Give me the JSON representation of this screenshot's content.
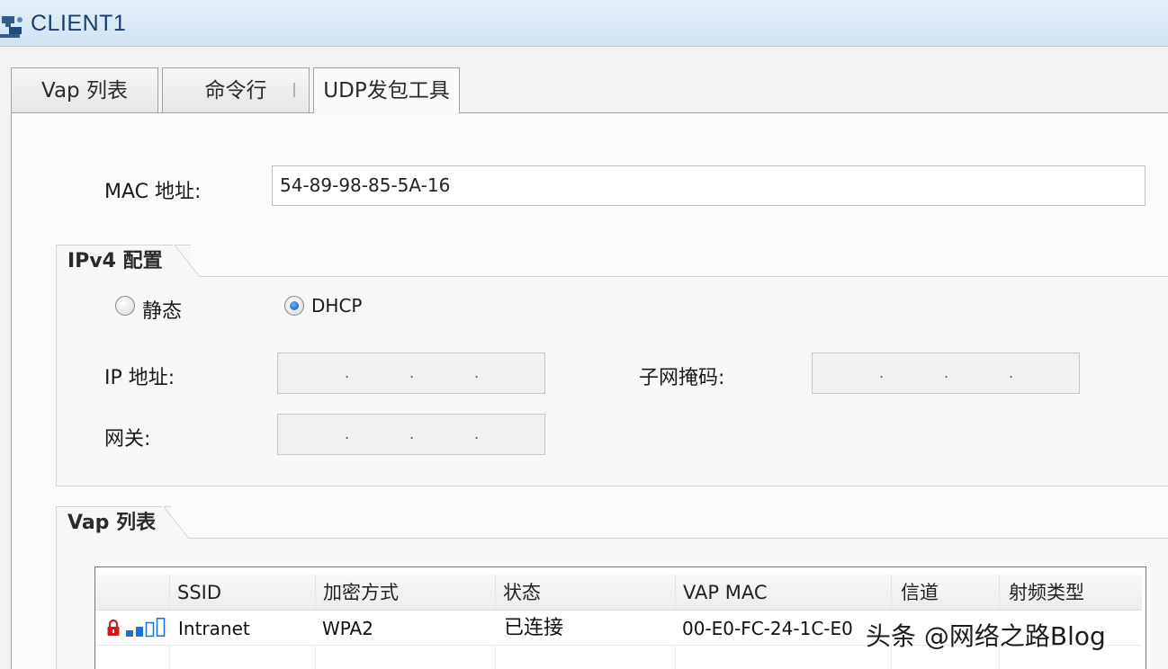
{
  "window": {
    "title": "CLIENT1"
  },
  "tabs": [
    {
      "label": "Vap 列表"
    },
    {
      "label": "命令行"
    },
    {
      "label": "UDP发包工具"
    }
  ],
  "mac": {
    "label": "MAC 地址:",
    "value": "54-89-98-85-5A-16"
  },
  "ipv4": {
    "legend": "IPv4 配置",
    "static_label": "静态",
    "dhcp_label": "DHCP",
    "selected": "DHCP",
    "ip_label": "IP 地址:",
    "mask_label": "子网掩码:",
    "gateway_label": "网关:",
    "ip_value": "",
    "mask_value": "",
    "gateway_value": ""
  },
  "vap_list": {
    "legend": "Vap 列表",
    "columns": [
      "SSID",
      "加密方式",
      "状态",
      "VAP MAC",
      "信道",
      "射频类型"
    ],
    "rows": [
      {
        "ssid": "Intranet",
        "encryption": "WPA2",
        "status": "已连接",
        "vap_mac": "00-E0-FC-24-1C-E0",
        "channel": "",
        "radio_type": "",
        "locked": true,
        "signal_bars": 2
      }
    ]
  },
  "watermark": {
    "text": "头条 @网络之路Blog"
  },
  "colors": {
    "title_text": "#183e6e",
    "signal_bar": "#1a6fd6",
    "lock": "#d01818"
  },
  "icons": {
    "app": "network-client-icon",
    "lock": "lock-icon",
    "signal": "signal-strength-icon"
  }
}
